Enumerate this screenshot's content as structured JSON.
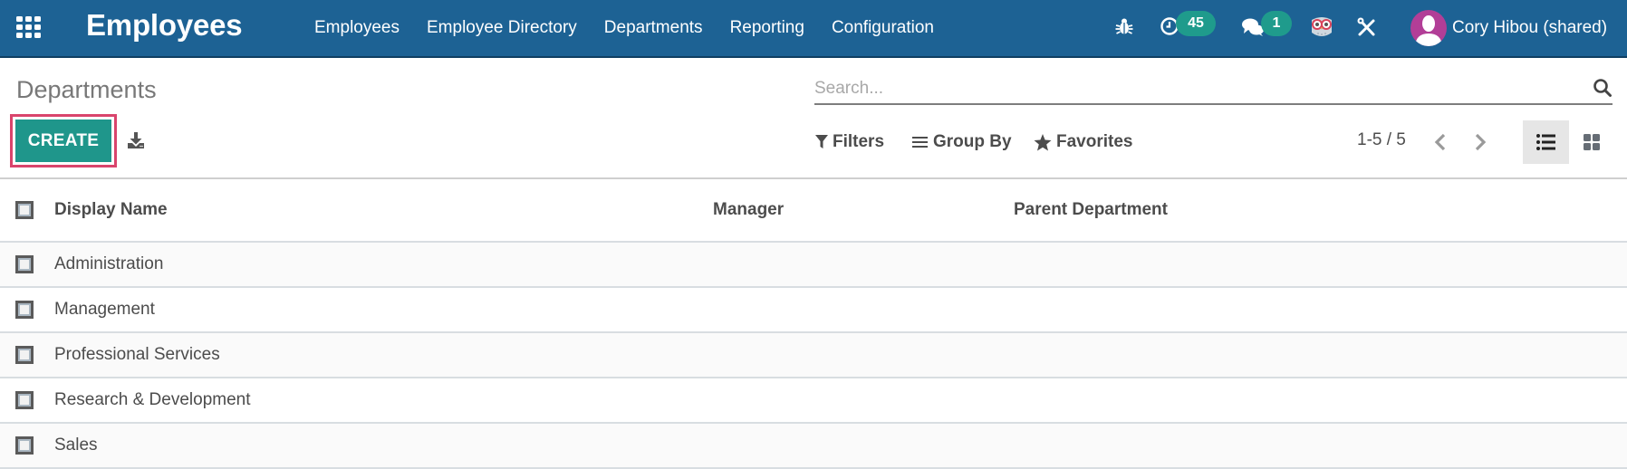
{
  "navbar": {
    "app_title": "Employees",
    "menu": [
      {
        "label": "Employees"
      },
      {
        "label": "Employee Directory"
      },
      {
        "label": "Departments"
      },
      {
        "label": "Reporting"
      },
      {
        "label": "Configuration"
      }
    ],
    "activity_count": "45",
    "message_count": "1",
    "user_name": "Cory Hibou (shared)",
    "colors": {
      "bar": "#1d6294",
      "badge": "#1f9b8c",
      "avatar": "#b23e97"
    }
  },
  "control_panel": {
    "page_title": "Departments",
    "search_placeholder": "Search...",
    "create_label": "CREATE",
    "filters_label": "Filters",
    "group_by_label": "Group By",
    "favorites_label": "Favorites",
    "pager": "1-5 / 5",
    "active_view": "list",
    "colors": {
      "create": "#1f968b",
      "highlight": "#d9446c"
    }
  },
  "table": {
    "columns": [
      "Display Name",
      "Manager",
      "Parent Department"
    ],
    "rows": [
      {
        "display_name": "Administration",
        "manager": "",
        "parent_department": ""
      },
      {
        "display_name": "Management",
        "manager": "",
        "parent_department": ""
      },
      {
        "display_name": "Professional Services",
        "manager": "",
        "parent_department": ""
      },
      {
        "display_name": "Research & Development",
        "manager": "",
        "parent_department": ""
      },
      {
        "display_name": "Sales",
        "manager": "",
        "parent_department": ""
      }
    ]
  }
}
